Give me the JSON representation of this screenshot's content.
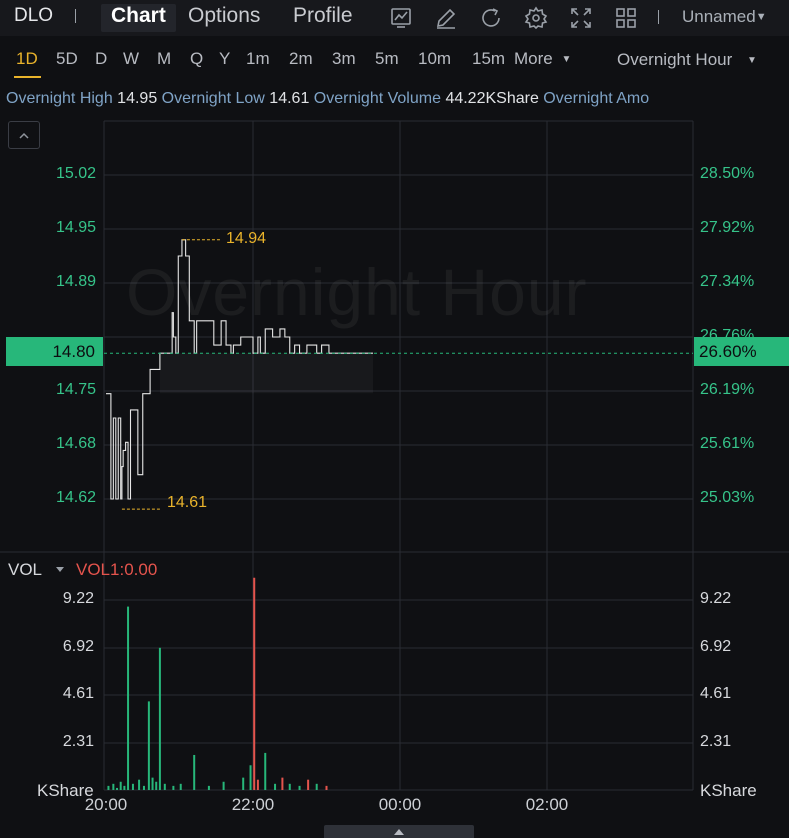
{
  "header": {
    "ticker": "DLO",
    "tabs": [
      {
        "label": "Chart",
        "active": true
      },
      {
        "label": "Options",
        "active": false
      },
      {
        "label": "Profile",
        "active": false
      }
    ],
    "toolbar_icons": [
      "indicator-icon",
      "draw-icon",
      "refresh-icon",
      "settings-icon",
      "fullscreen-icon",
      "layout-icon"
    ],
    "layout_name": "Unnamed"
  },
  "periods": {
    "items": [
      "1D",
      "5D",
      "D",
      "W",
      "M",
      "Q",
      "Y",
      "1m",
      "2m",
      "3m",
      "5m",
      "10m",
      "15m"
    ],
    "active": "1D",
    "more_label": "More",
    "session_label": "Overnight Hour"
  },
  "info": {
    "high_label": "Overnight High",
    "high_value": "14.95",
    "low_label": "Overnight Low",
    "low_value": "14.61",
    "volume_label": "Overnight Volume",
    "volume_value": "44.22KShare",
    "amount_label": "Overnight Amo"
  },
  "price_pane": {
    "watermark": "Overnight Hour",
    "left_ticks": [
      "15.02",
      "14.95",
      "14.89",
      "14.82",
      "14.75",
      "14.68",
      "14.62"
    ],
    "right_ticks": [
      "28.50%",
      "27.92%",
      "27.34%",
      "26.76%",
      "26.19%",
      "25.61%",
      "25.03%"
    ],
    "current_price": "14.80",
    "current_pct": "26.60%",
    "high_marker": "14.94",
    "low_marker": "14.61"
  },
  "vol_pane": {
    "label": "VOL",
    "indicator": "VOL1:0.00",
    "ticks": [
      "9.22",
      "6.92",
      "4.61",
      "2.31"
    ],
    "unit": "KShare"
  },
  "time_axis": [
    "20:00",
    "22:00",
    "00:00",
    "02:00"
  ],
  "colors": {
    "up": "#27b77a",
    "down": "#e5544d",
    "accent": "#e9b32b",
    "price_line": "#e6e6e6"
  },
  "chart_data": {
    "type": "line",
    "price_series": {
      "time_minutes_since_20": [
        0,
        2,
        4,
        5,
        6,
        8,
        10,
        12,
        13,
        14,
        16,
        18,
        20,
        22,
        24,
        26,
        28,
        30,
        33,
        36,
        40,
        44,
        48,
        52,
        54,
        55,
        57,
        59,
        62,
        65,
        68,
        70,
        72,
        74,
        76,
        78,
        80,
        82,
        84,
        86,
        88,
        90,
        92,
        94,
        96,
        98,
        100,
        102,
        104,
        106,
        108,
        110,
        112,
        114,
        116,
        118,
        120,
        122,
        124,
        126,
        128,
        130,
        132,
        134,
        136,
        138,
        140,
        142,
        144,
        146,
        148,
        150,
        152,
        154,
        156,
        158,
        160,
        162,
        164,
        166,
        168,
        170,
        172,
        174,
        176,
        178,
        180,
        182,
        184,
        186,
        188,
        190,
        192,
        194,
        196,
        198,
        200,
        202,
        204,
        206,
        208,
        210,
        212,
        214,
        216,
        218
      ],
      "price": [
        14.75,
        14.75,
        14.62,
        14.62,
        14.72,
        14.62,
        14.72,
        14.62,
        14.66,
        14.68,
        14.69,
        14.62,
        14.73,
        14.73,
        14.73,
        14.65,
        14.65,
        14.75,
        14.75,
        14.78,
        14.78,
        14.8,
        14.8,
        14.8,
        14.85,
        14.82,
        14.8,
        14.92,
        14.94,
        14.92,
        14.84,
        14.84,
        14.8,
        14.84,
        14.84,
        14.84,
        14.84,
        14.84,
        14.84,
        14.84,
        14.81,
        14.81,
        14.81,
        14.84,
        14.84,
        14.81,
        14.81,
        14.8,
        14.81,
        14.81,
        14.81,
        14.82,
        14.82,
        14.82,
        14.82,
        14.82,
        14.8,
        14.8,
        14.82,
        14.8,
        14.8,
        14.83,
        14.83,
        14.83,
        14.82,
        14.82,
        14.82,
        14.83,
        14.83,
        14.82,
        14.82,
        14.8,
        14.8,
        14.81,
        14.81,
        14.8,
        14.8,
        14.8,
        14.81,
        14.81,
        14.81,
        14.81,
        14.8,
        14.8,
        14.81,
        14.81,
        14.81,
        14.8,
        14.8,
        14.8,
        14.8,
        14.8,
        14.8,
        14.8,
        14.8,
        14.8,
        14.8,
        14.8,
        14.8,
        14.8,
        14.8,
        14.8,
        14.8,
        14.8,
        14.8,
        14.8
      ],
      "ylim": [
        14.56,
        15.06
      ],
      "xlim_hours": [
        "20:00",
        "04:00"
      ]
    },
    "volume_series": {
      "unit": "KShare",
      "bars": [
        {
          "t": 2,
          "v": 0.2,
          "dir": "up"
        },
        {
          "t": 6,
          "v": 0.3,
          "dir": "up"
        },
        {
          "t": 9,
          "v": 0.1,
          "dir": "up"
        },
        {
          "t": 12,
          "v": 0.4,
          "dir": "up"
        },
        {
          "t": 15,
          "v": 0.2,
          "dir": "up"
        },
        {
          "t": 18,
          "v": 8.9,
          "dir": "up"
        },
        {
          "t": 22,
          "v": 0.3,
          "dir": "up"
        },
        {
          "t": 27,
          "v": 0.5,
          "dir": "up"
        },
        {
          "t": 31,
          "v": 0.2,
          "dir": "up"
        },
        {
          "t": 35,
          "v": 4.3,
          "dir": "up"
        },
        {
          "t": 38,
          "v": 0.6,
          "dir": "up"
        },
        {
          "t": 41,
          "v": 0.4,
          "dir": "up"
        },
        {
          "t": 44,
          "v": 6.9,
          "dir": "up"
        },
        {
          "t": 48,
          "v": 0.3,
          "dir": "up"
        },
        {
          "t": 55,
          "v": 0.2,
          "dir": "up"
        },
        {
          "t": 61,
          "v": 0.3,
          "dir": "up"
        },
        {
          "t": 72,
          "v": 1.7,
          "dir": "up"
        },
        {
          "t": 84,
          "v": 0.2,
          "dir": "up"
        },
        {
          "t": 96,
          "v": 0.4,
          "dir": "up"
        },
        {
          "t": 112,
          "v": 0.6,
          "dir": "up"
        },
        {
          "t": 118,
          "v": 1.2,
          "dir": "up"
        },
        {
          "t": 121,
          "v": 10.3,
          "dir": "down"
        },
        {
          "t": 124,
          "v": 0.5,
          "dir": "down"
        },
        {
          "t": 130,
          "v": 1.8,
          "dir": "up"
        },
        {
          "t": 138,
          "v": 0.3,
          "dir": "up"
        },
        {
          "t": 144,
          "v": 0.6,
          "dir": "down"
        },
        {
          "t": 150,
          "v": 0.3,
          "dir": "up"
        },
        {
          "t": 158,
          "v": 0.2,
          "dir": "up"
        },
        {
          "t": 165,
          "v": 0.5,
          "dir": "down"
        },
        {
          "t": 172,
          "v": 0.3,
          "dir": "up"
        },
        {
          "t": 180,
          "v": 0.2,
          "dir": "down"
        }
      ],
      "ylim": [
        0,
        11
      ]
    }
  }
}
